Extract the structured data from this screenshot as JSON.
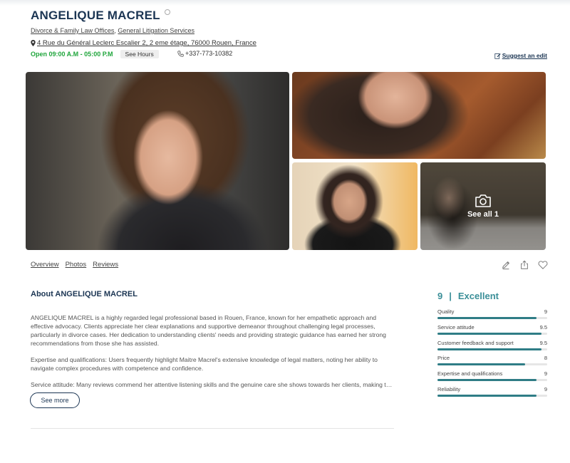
{
  "business": {
    "name": "ANGELIQUE MACREL",
    "categories": [
      "Divorce & Family Law Offices",
      "General Litigation Services"
    ],
    "address": "4 Rue du Général Leclerc Escalier 2, 2 eme étage, 76000 Rouen, France",
    "hours_status": "Open 09:00 A.M - 05:00 P.M",
    "see_hours_label": "See Hours",
    "phone": "+337-773-10382",
    "suggest_edit_label": "Suggest an edit"
  },
  "gallery": {
    "see_all_label": "See all 1"
  },
  "tabs": [
    "Overview",
    "Photos",
    "Reviews"
  ],
  "about": {
    "title": "About ANGELIQUE MACREL",
    "paragraphs": [
      "ANGELIQUE MACREL is a highly regarded legal professional based in Rouen, France, known for her empathetic approach and effective advocacy. Clients appreciate her clear explanations and supportive demeanor throughout challenging legal processes, particularly in divorce cases. Her dedication to understanding clients' needs and providing strategic guidance has earned her strong recommendations from those she has assisted.",
      "Expertise and qualifications: Users frequently highlight Maitre Macrel's extensive knowledge of legal matters, noting her ability to navigate complex procedures with competence and confidence.",
      "Service attitude: Many reviews commend her attentive listening skills and the genuine care she shows towards her clients, making the..."
    ],
    "see_more_label": "See more"
  },
  "rating": {
    "score": "9",
    "separator": "|",
    "label": "Excellent",
    "max": 10,
    "metrics": [
      {
        "label": "Quality",
        "value": "9"
      },
      {
        "label": "Service attitude",
        "value": "9.5"
      },
      {
        "label": "Customer feedback and support",
        "value": "9.5"
      },
      {
        "label": "Price",
        "value": "8"
      },
      {
        "label": "Expertise and qualifications",
        "value": "9"
      },
      {
        "label": "Reliability",
        "value": "9"
      }
    ]
  },
  "colors": {
    "title": "#1b3553",
    "open": "#1fa53b",
    "rating": "#3b8f98",
    "bar_fill": "#2f7d86"
  },
  "icons": [
    "info-icon",
    "location-pin-icon",
    "phone-icon",
    "edit-icon",
    "camera-icon",
    "pencil-icon",
    "share-icon",
    "heart-icon"
  ]
}
